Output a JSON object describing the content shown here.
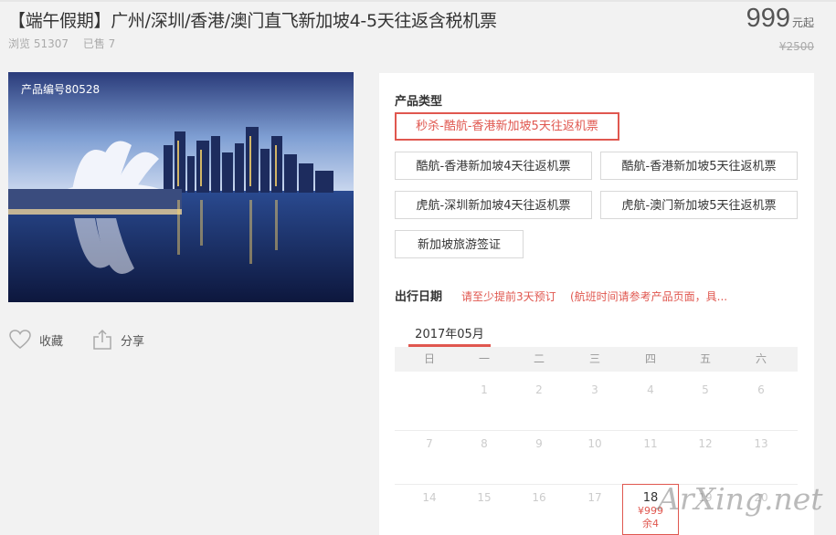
{
  "product": {
    "title": "【端午假期】广州/深圳/香港/澳门直飞新加坡4-5天往返含税机票",
    "views_label": "浏览 51307",
    "sold_label": "已售 7",
    "price": "999",
    "price_unit": "元起",
    "original_price": "¥2500",
    "product_code": "产品编号80528"
  },
  "actions": {
    "favorite": "收藏",
    "share": "分享"
  },
  "product_types": {
    "label": "产品类型",
    "options": [
      "秒杀-酷航-香港新加坡5天往返机票",
      "酷航-香港新加坡4天往返机票",
      "酷航-香港新加坡5天往返机票",
      "虎航-深圳新加坡4天往返机票",
      "虎航-澳门新加坡5天往返机票",
      "新加坡旅游签证"
    ],
    "selected_index": 0
  },
  "departure": {
    "label": "出行日期",
    "notice1": "请至少提前3天预订",
    "notice2": "(航班时间请参考产品页面，具..."
  },
  "calendar": {
    "month": "2017年05月",
    "weekdays": [
      "日",
      "一",
      "二",
      "三",
      "四",
      "五",
      "六"
    ],
    "rows": [
      [
        "",
        "1",
        "2",
        "3",
        "4",
        "5",
        "6"
      ],
      [
        "7",
        "8",
        "9",
        "10",
        "11",
        "12",
        "13"
      ],
      [
        "14",
        "15",
        "16",
        "17",
        "18",
        "19",
        "20"
      ]
    ],
    "active_day": {
      "day": "18",
      "price": "¥999",
      "left": "余4"
    }
  },
  "watermark": "ArXing.net",
  "colors": {
    "accent": "#e0574f",
    "background": "#f2f2f2",
    "panel": "#ffffff"
  }
}
